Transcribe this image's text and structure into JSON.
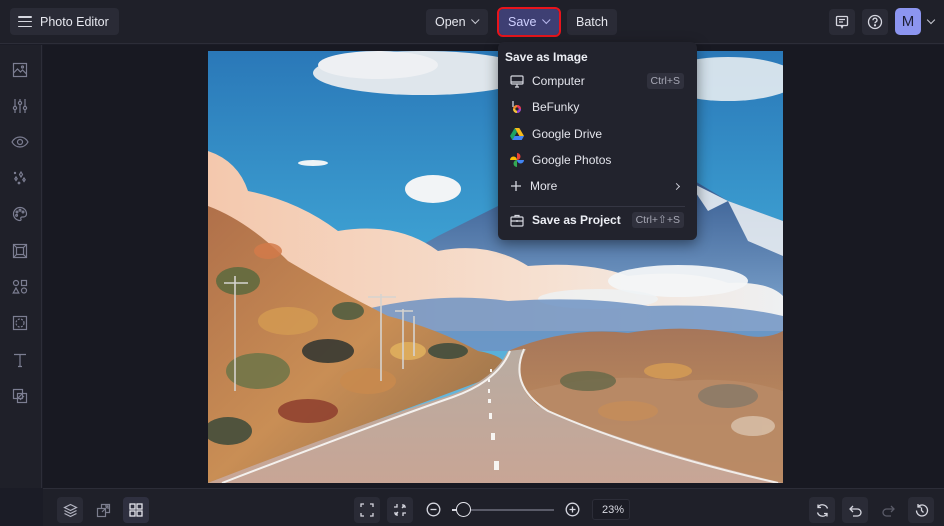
{
  "app": {
    "title": "Photo Editor"
  },
  "toolbar": {
    "open_label": "Open",
    "save_label": "Save",
    "batch_label": "Batch",
    "avatar_initial": "M",
    "icons": [
      "feedback-icon",
      "help-icon"
    ]
  },
  "sidebar": {
    "items": [
      {
        "name": "image-manager",
        "icon": "image-icon"
      },
      {
        "name": "edit",
        "icon": "sliders-icon"
      },
      {
        "name": "touch-up",
        "icon": "eye-icon"
      },
      {
        "name": "effects",
        "icon": "sparkle-icon"
      },
      {
        "name": "artsy",
        "icon": "palette-icon"
      },
      {
        "name": "frames",
        "icon": "frame-icon"
      },
      {
        "name": "graphics",
        "icon": "shapes-icon"
      },
      {
        "name": "overlays",
        "icon": "overlay-icon"
      },
      {
        "name": "text",
        "icon": "text-icon"
      },
      {
        "name": "textures",
        "icon": "texture-icon"
      }
    ]
  },
  "save_menu": {
    "header": "Save as Image",
    "items": [
      {
        "label": "Computer",
        "icon": "monitor-icon",
        "shortcut": "Ctrl+S"
      },
      {
        "label": "BeFunky",
        "icon": "befunky-icon",
        "shortcut": ""
      },
      {
        "label": "Google Drive",
        "icon": "google-drive-icon",
        "shortcut": ""
      },
      {
        "label": "Google Photos",
        "icon": "google-photos-icon",
        "shortcut": ""
      },
      {
        "label": "More",
        "icon": "plus-icon",
        "submenu": true
      }
    ],
    "project": {
      "label": "Save as Project",
      "icon": "briefcase-icon",
      "shortcut": "Ctrl+⇧+S"
    }
  },
  "canvas": {
    "image_description": "Watercolor-style painting of a road leading toward snow-capped mountains under a blue sky with clouds"
  },
  "bottombar": {
    "left_icons": [
      "layers-icon",
      "resize-icon",
      "grid-icon"
    ],
    "zoom": {
      "value_label": "23%",
      "value_percent": 23,
      "slider_fraction": 0.05
    },
    "right_icons": [
      "refresh-icon",
      "undo-icon",
      "redo-icon",
      "history-icon"
    ]
  }
}
